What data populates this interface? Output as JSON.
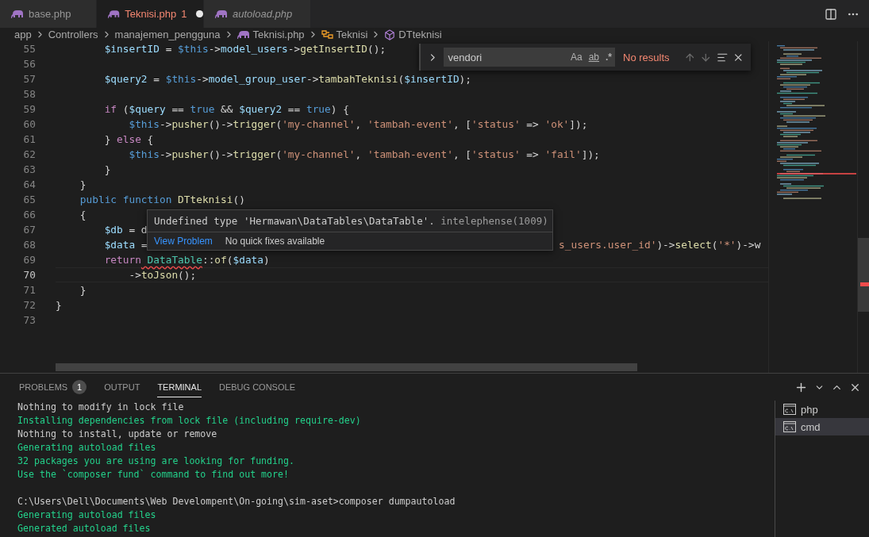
{
  "tabs": [
    {
      "label": "base.php",
      "selected": false,
      "modified": false,
      "preview": false
    },
    {
      "label": "Teknisi.php",
      "selected": true,
      "problems": "1",
      "modified": true,
      "preview": false
    },
    {
      "label": "autoload.php",
      "selected": false,
      "modified": false,
      "preview": true
    }
  ],
  "breadcrumb": [
    {
      "kind": "folder",
      "label": "app"
    },
    {
      "kind": "folder",
      "label": "Controllers"
    },
    {
      "kind": "folder",
      "label": "manajemen_pengguna"
    },
    {
      "kind": "file",
      "label": "Teknisi.php"
    },
    {
      "kind": "class",
      "label": "Teknisi"
    },
    {
      "kind": "method",
      "label": "DTteknisi"
    }
  ],
  "code": [
    {
      "number": "55",
      "current": false,
      "tokens": [
        {
          "kind": "var",
          "text": "        $insertID"
        },
        {
          "kind": "plain",
          "text": " = "
        },
        {
          "kind": "kw",
          "text": "$this"
        },
        {
          "kind": "plain",
          "text": "->"
        },
        {
          "kind": "var",
          "text": "model_users"
        },
        {
          "kind": "plain",
          "text": "->"
        },
        {
          "kind": "fn",
          "text": "getInsertID"
        },
        {
          "kind": "plain",
          "text": "();"
        }
      ]
    },
    {
      "number": "56",
      "current": false
    },
    {
      "number": "57",
      "current": false,
      "tokens": [
        {
          "kind": "var",
          "text": "        $query2"
        },
        {
          "kind": "plain",
          "text": " = "
        },
        {
          "kind": "kw",
          "text": "$this"
        },
        {
          "kind": "plain",
          "text": "->"
        },
        {
          "kind": "var",
          "text": "model_group_user"
        },
        {
          "kind": "plain",
          "text": "->"
        },
        {
          "kind": "fn",
          "text": "tambahTeknisi"
        },
        {
          "kind": "plain",
          "text": "("
        },
        {
          "kind": "var",
          "text": "$insertID"
        },
        {
          "kind": "plain",
          "text": ");"
        }
      ]
    },
    {
      "number": "58",
      "current": false
    },
    {
      "number": "59",
      "current": false,
      "tokens": [
        {
          "kind": "ctrl",
          "text": "        if"
        },
        {
          "kind": "plain",
          "text": " ("
        },
        {
          "kind": "var",
          "text": "$query"
        },
        {
          "kind": "plain",
          "text": " == "
        },
        {
          "kind": "kw",
          "text": "true"
        },
        {
          "kind": "plain",
          "text": " && "
        },
        {
          "kind": "var",
          "text": "$query2"
        },
        {
          "kind": "plain",
          "text": " == "
        },
        {
          "kind": "kw",
          "text": "true"
        },
        {
          "kind": "plain",
          "text": ") {"
        }
      ]
    },
    {
      "number": "60",
      "current": false,
      "tokens": [
        {
          "kind": "kw",
          "text": "            $this"
        },
        {
          "kind": "plain",
          "text": "->"
        },
        {
          "kind": "fn",
          "text": "pusher"
        },
        {
          "kind": "plain",
          "text": "()->"
        },
        {
          "kind": "fn",
          "text": "trigger"
        },
        {
          "kind": "plain",
          "text": "("
        },
        {
          "kind": "str",
          "text": "'my-channel'"
        },
        {
          "kind": "plain",
          "text": ", "
        },
        {
          "kind": "str",
          "text": "'tambah-event'"
        },
        {
          "kind": "plain",
          "text": ", ["
        },
        {
          "kind": "str",
          "text": "'status'"
        },
        {
          "kind": "plain",
          "text": " => "
        },
        {
          "kind": "str",
          "text": "'ok'"
        },
        {
          "kind": "plain",
          "text": "]);"
        }
      ]
    },
    {
      "number": "61",
      "current": false,
      "tokens": [
        {
          "kind": "plain",
          "text": "        } "
        },
        {
          "kind": "ctrl",
          "text": "else"
        },
        {
          "kind": "plain",
          "text": " {"
        }
      ]
    },
    {
      "number": "62",
      "current": false,
      "tokens": [
        {
          "kind": "kw",
          "text": "            $this"
        },
        {
          "kind": "plain",
          "text": "->"
        },
        {
          "kind": "fn",
          "text": "pusher"
        },
        {
          "kind": "plain",
          "text": "()->"
        },
        {
          "kind": "fn",
          "text": "trigger"
        },
        {
          "kind": "plain",
          "text": "("
        },
        {
          "kind": "str",
          "text": "'my-channel'"
        },
        {
          "kind": "plain",
          "text": ", "
        },
        {
          "kind": "str",
          "text": "'tambah-event'"
        },
        {
          "kind": "plain",
          "text": ", ["
        },
        {
          "kind": "str",
          "text": "'status'"
        },
        {
          "kind": "plain",
          "text": " => "
        },
        {
          "kind": "str",
          "text": "'fail'"
        },
        {
          "kind": "plain",
          "text": "]);"
        }
      ]
    },
    {
      "number": "63",
      "current": false,
      "tokens": [
        {
          "kind": "plain",
          "text": "        }"
        }
      ]
    },
    {
      "number": "64",
      "current": false,
      "tokens": [
        {
          "kind": "plain",
          "text": "    }"
        }
      ]
    },
    {
      "number": "65",
      "current": false,
      "tokens": [
        {
          "kind": "kw",
          "text": "    public function"
        },
        {
          "kind": "fn",
          "text": " DTteknisi"
        },
        {
          "kind": "plain",
          "text": "()"
        }
      ]
    },
    {
      "number": "66",
      "current": false,
      "tokens": [
        {
          "kind": "plain",
          "text": "    {"
        }
      ]
    },
    {
      "number": "67",
      "current": false,
      "tokens": [
        {
          "kind": "var",
          "text": "        $db"
        },
        {
          "kind": "plain",
          "text": " = d"
        }
      ]
    },
    {
      "number": "68",
      "current": false,
      "tokens": [
        {
          "kind": "var",
          "text": "        $data"
        },
        {
          "kind": "plain",
          "text": " ="
        },
        {
          "kind": "gap"
        },
        {
          "kind": "str",
          "text": "s_users.user_id'"
        },
        {
          "kind": "plain",
          "text": ")->"
        },
        {
          "kind": "fn",
          "text": "select"
        },
        {
          "kind": "plain",
          "text": "("
        },
        {
          "kind": "str",
          "text": "'*'"
        },
        {
          "kind": "plain",
          "text": ")->w"
        }
      ]
    },
    {
      "number": "69",
      "current": false,
      "tokens": [
        {
          "kind": "ctrl",
          "text": "        return"
        },
        {
          "kind": "cls",
          "text": " DataTable",
          "error": true
        },
        {
          "kind": "plain",
          "text": "::"
        },
        {
          "kind": "fn",
          "text": "of"
        },
        {
          "kind": "plain",
          "text": "("
        },
        {
          "kind": "var",
          "text": "$data"
        },
        {
          "kind": "plain",
          "text": ")"
        }
      ]
    },
    {
      "number": "70",
      "current": true,
      "tokens": [
        {
          "kind": "plain",
          "text": "            ->"
        },
        {
          "kind": "fn",
          "text": "toJson"
        },
        {
          "kind": "plain",
          "text": "();"
        }
      ]
    },
    {
      "number": "71",
      "current": false,
      "tokens": [
        {
          "kind": "plain",
          "text": "    }"
        }
      ]
    },
    {
      "number": "72",
      "current": false,
      "tokens": [
        {
          "kind": "plain",
          "text": "}"
        }
      ]
    },
    {
      "number": "73",
      "current": false
    }
  ],
  "hover": {
    "message": "Undefined type 'Hermawan\\DataTables\\DataTable'.",
    "source": "intelephense(1009)",
    "action": "View Problem",
    "note": "No quick fixes available"
  },
  "find": {
    "value": "vendori",
    "options": [
      {
        "kind": "case",
        "label": "Aa"
      },
      {
        "kind": "word",
        "label": "ab"
      },
      {
        "kind": "regex",
        "label": ".*"
      }
    ],
    "result": "No results"
  },
  "panel": {
    "tabs": [
      {
        "label": "PROBLEMS",
        "badge": "1",
        "selected": false
      },
      {
        "label": "OUTPUT",
        "selected": false
      },
      {
        "label": "TERMINAL",
        "selected": true
      },
      {
        "label": "DEBUG CONSOLE",
        "selected": false
      }
    ],
    "terminal": [
      {
        "kind": "info",
        "text": "Nothing to modify in lock file"
      },
      {
        "kind": "success",
        "text": "Installing dependencies from lock file (including require-dev)"
      },
      {
        "kind": "info",
        "text": "Nothing to install, update or remove"
      },
      {
        "kind": "success",
        "text": "Generating autoload files"
      },
      {
        "kind": "success",
        "text": "32 packages you are using are looking for funding."
      },
      {
        "kind": "success",
        "text": "Use the `composer fund` command to find out more!"
      },
      {
        "kind": "blank"
      },
      {
        "kind": "info",
        "text": "C:\\Users\\Dell\\Documents\\Web Develompent\\On-going\\sim-aset>composer dumpautoload"
      },
      {
        "kind": "success",
        "text": "Generating autoload files"
      },
      {
        "kind": "success",
        "text": "Generated autoload files"
      }
    ],
    "sessions": [
      {
        "label": "php",
        "selected": false
      },
      {
        "label": "cmd",
        "selected": true
      }
    ]
  }
}
